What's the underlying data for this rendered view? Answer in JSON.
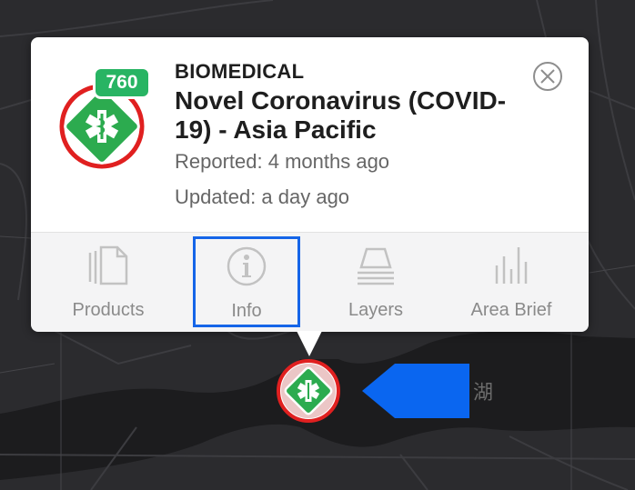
{
  "event": {
    "category": "BIOMEDICAL",
    "title": "Novel Coronavirus (COVID-19) - Asia Pacific",
    "reported": "Reported: 4 months ago",
    "updated": "Updated: a day ago",
    "count": "760"
  },
  "toolbar": {
    "products_label": "Products",
    "info_label": "Info",
    "layers_label": "Layers",
    "area_brief_label": "Area Brief",
    "selected": "Info"
  },
  "map": {
    "label_text": "湖"
  },
  "colors": {
    "hazard_green": "#2cab4f",
    "hazard_ring": "#e02020",
    "count_badge": "#28b463",
    "selection_outline": "#1565e8",
    "callout_arrow": "#0a66f0",
    "map_background": "#2b2b2e"
  },
  "icons": {
    "hazard": "medical-star-of-life-icon",
    "close": "close-circle-icon",
    "products": "documents-icon",
    "info": "info-circle-icon",
    "layers": "layers-stack-icon",
    "area_brief": "bar-chart-icon",
    "callout": "left-arrow-icon"
  }
}
